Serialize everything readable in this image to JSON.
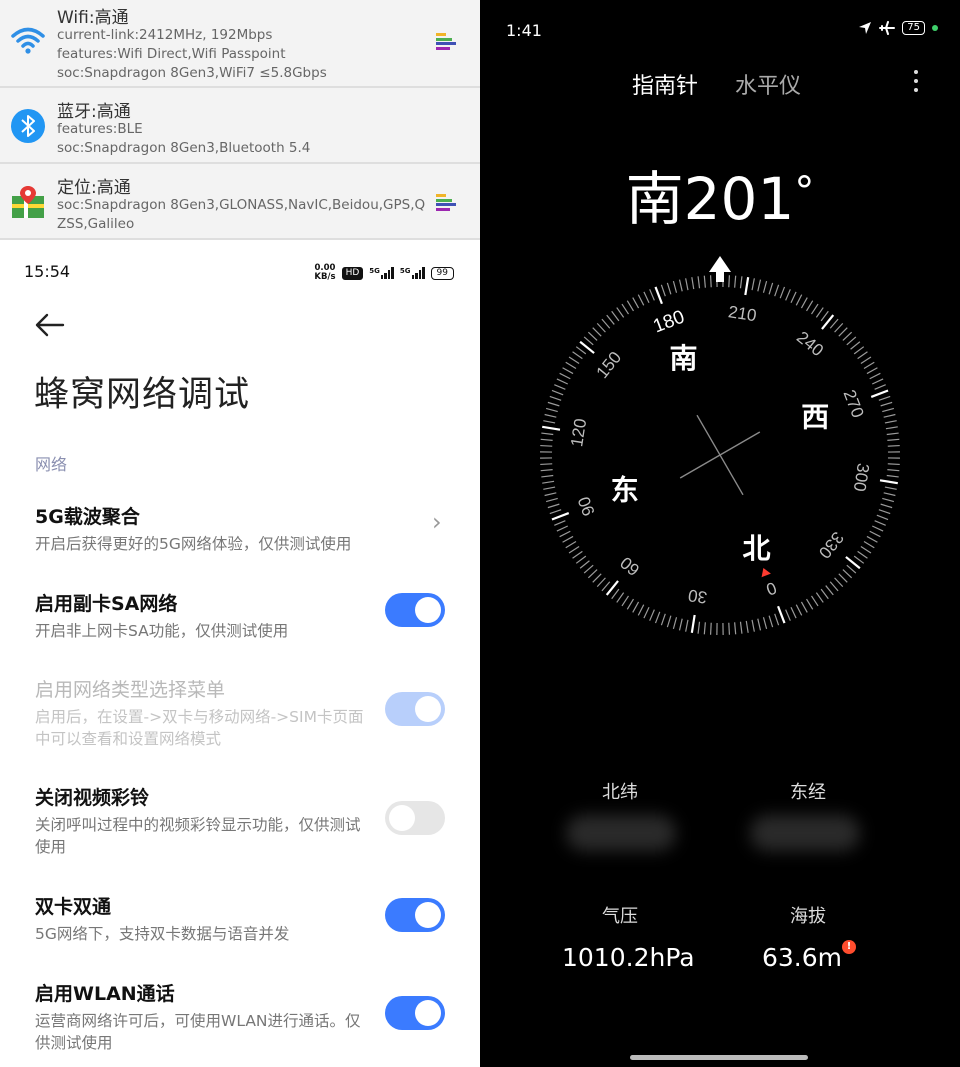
{
  "left_panel": {
    "hardware_cards": [
      {
        "title": "Wifi:高通",
        "lines": [
          "current-link:2412MHz, 192Mbps",
          "features:Wifi Direct,Wifi Passpoint",
          "soc:Snapdragon 8Gen3,WiFi7 ≤5.8Gbps"
        ]
      },
      {
        "title": "蓝牙:高通",
        "lines": [
          "features:BLE",
          "soc:Snapdragon 8Gen3,Bluetooth 5.4"
        ]
      },
      {
        "title": "定位:高通",
        "lines": [
          "soc:Snapdragon 8Gen3,GLONASS,NavIC,Beidou,GPS,Q",
          "ZSS,Galileo"
        ]
      }
    ],
    "status_bar": {
      "time": "15:54",
      "net_speed_top": "0.00",
      "net_speed_unit": "KB/s",
      "hd_badge": "HD",
      "sim1": "5G",
      "sim2": "5G",
      "battery": "99"
    },
    "page_title": "蜂窝网络调试",
    "section_label": "网络",
    "settings": [
      {
        "title": "5G载波聚合",
        "desc": "开启后获得更好的5G网络体验，仅供测试使用",
        "control": "chevron"
      },
      {
        "title": "启用副卡SA网络",
        "desc": "开启非上网卡SA功能，仅供测试使用",
        "control": "on"
      },
      {
        "title": "启用网络类型选择菜单",
        "desc": "启用后，在设置->双卡与移动网络->SIM卡页面中可以查看和设置网络模式",
        "control": "on-disabled"
      },
      {
        "title": "关闭视频彩铃",
        "desc": "关闭呼叫过程中的视频彩铃显示功能，仅供测试使用",
        "control": "off"
      },
      {
        "title": "双卡双通",
        "desc": "5G网络下，支持双卡数据与语音并发",
        "control": "on"
      },
      {
        "title": "启用WLAN通话",
        "desc": "运营商网络许可后，可使用WLAN进行通话。仅供测试使用",
        "control": "on"
      }
    ],
    "colors": {
      "toggle_on": "#3b7bff",
      "toggle_off": "#e6e6e6",
      "section": "#8a8fb0"
    }
  },
  "right_panel": {
    "status_bar": {
      "time": "1:41",
      "battery": "75"
    },
    "tabs": {
      "compass": "指南针",
      "level": "水平仪"
    },
    "heading": {
      "direction": "南",
      "degrees": "201",
      "degree_symbol": "°"
    },
    "compass": {
      "heading_deg": 201,
      "cardinals": {
        "north": "北",
        "south": "南",
        "east": "东",
        "west": "西"
      },
      "tick_labels": [
        "0",
        "30",
        "60",
        "90",
        "120",
        "150",
        "180",
        "210",
        "240",
        "270",
        "300",
        "330"
      ]
    },
    "info": {
      "lat_label": "北纬",
      "lon_label": "东经",
      "pressure_label": "气压",
      "pressure_value": "1010.2hPa",
      "altitude_label": "海拔",
      "altitude_value": "63.6m",
      "alert_mark": "!"
    }
  }
}
